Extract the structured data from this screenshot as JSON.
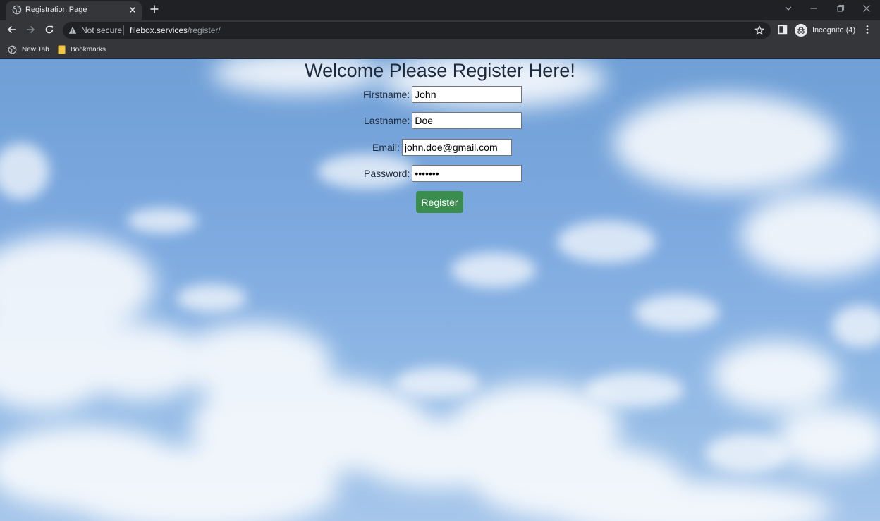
{
  "browser": {
    "tab_title": "Registration Page",
    "url_host": "filebox.services",
    "url_path": "/register/",
    "security_label": "Not secure",
    "profile_label": "Incognito (4)"
  },
  "bookmarks": [
    {
      "label": "New Tab"
    },
    {
      "label": "Bookmarks"
    }
  ],
  "page": {
    "title": "Welcome Please Register Here!",
    "form": {
      "firstname_label": "Firstname:",
      "firstname_value": "John",
      "lastname_label": "Lastname:",
      "lastname_value": "Doe",
      "email_label": "Email:",
      "email_value": "john.doe@gmail.com",
      "password_label": "Password:",
      "password_value": "•••••••",
      "submit_label": "Register"
    }
  },
  "colors": {
    "chrome_dark": "#202124",
    "chrome_toolbar": "#35363a",
    "register_button": "#3b8c4f",
    "sky": "#7eaae0"
  }
}
